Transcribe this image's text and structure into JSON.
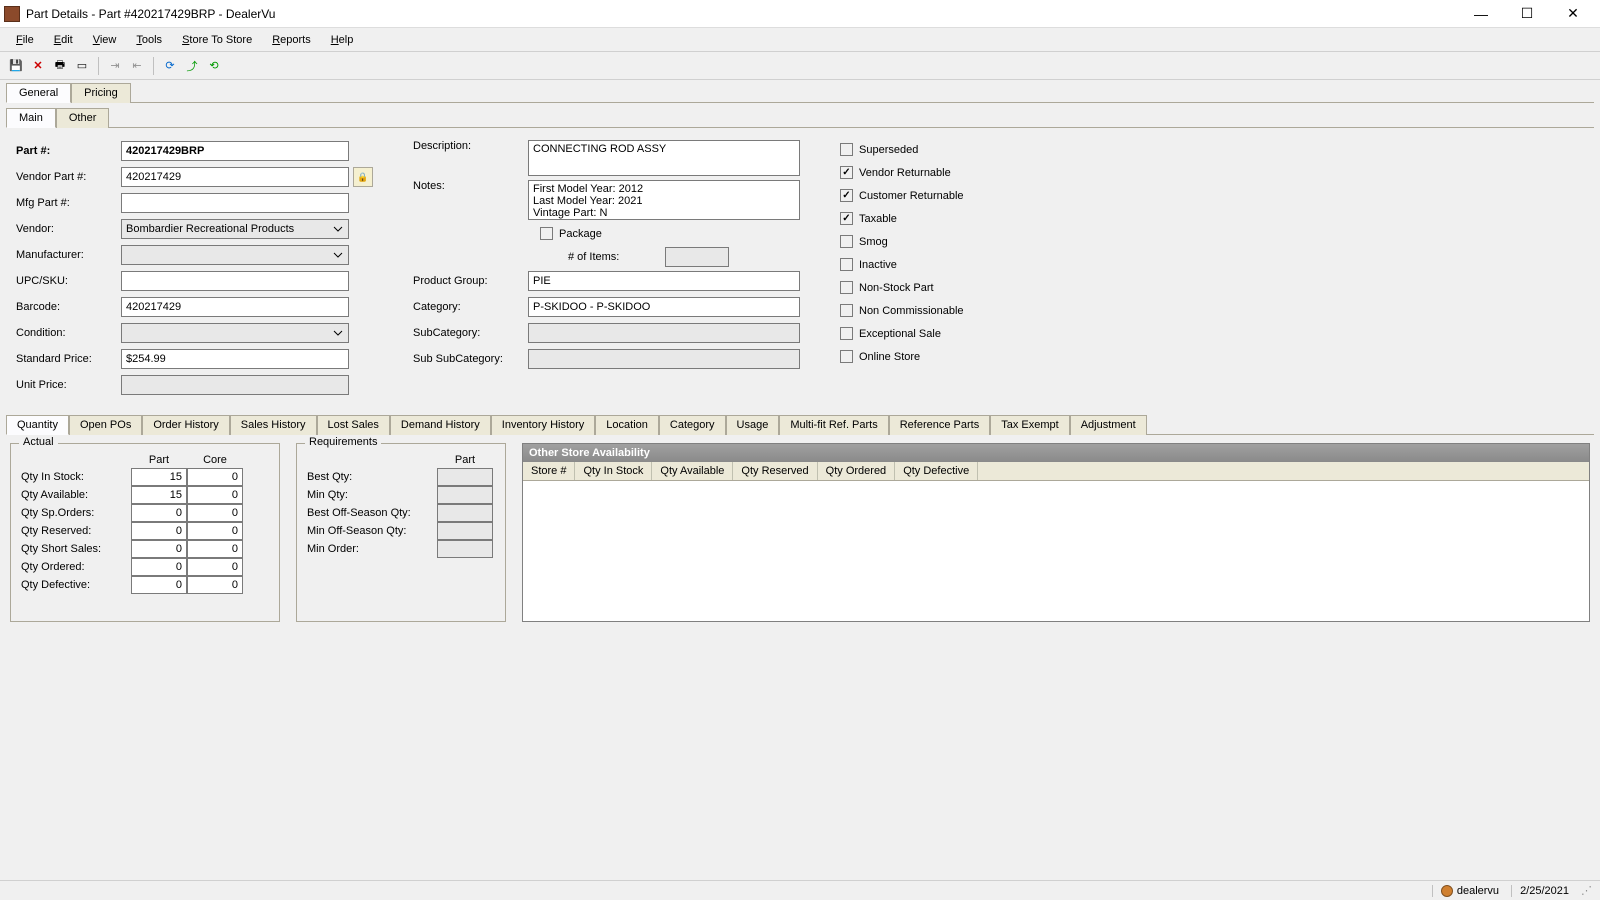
{
  "window": {
    "title": "Part Details - Part #420217429BRP - DealerVu"
  },
  "menu": {
    "file": "File",
    "edit": "Edit",
    "view": "View",
    "tools": "Tools",
    "store": "Store To Store",
    "reports": "Reports",
    "help": "Help"
  },
  "top_tabs": {
    "general": "General",
    "pricing": "Pricing"
  },
  "sub_tabs": {
    "main": "Main",
    "other": "Other"
  },
  "labels": {
    "part_no": "Part #:",
    "vendor_part": "Vendor Part #:",
    "mfg_part": "Mfg Part #:",
    "vendor": "Vendor:",
    "manufacturer": "Manufacturer:",
    "upc": "UPC/SKU:",
    "barcode": "Barcode:",
    "condition": "Condition:",
    "std_price": "Standard Price:",
    "unit_price": "Unit Price:",
    "description": "Description:",
    "notes": "Notes:",
    "package": "Package",
    "num_items": "# of Items:",
    "product_group": "Product Group:",
    "category": "Category:",
    "subcategory": "SubCategory:",
    "sub_sub": "Sub SubCategory:"
  },
  "fields": {
    "part_no": "420217429BRP",
    "vendor_part": "420217429",
    "mfg_part": "",
    "vendor": "Bombardier Recreational Products",
    "manufacturer": "",
    "upc": "",
    "barcode": "420217429",
    "condition": "",
    "std_price": "$254.99",
    "unit_price": "",
    "description": "CONNECTING ROD ASSY",
    "notes": "First Model Year: 2012\nLast Model Year: 2021\nVintage Part: N",
    "num_items": "",
    "product_group": "PIE",
    "category": "P-SKIDOO - P-SKIDOO",
    "subcategory": "",
    "sub_sub": ""
  },
  "checks": {
    "superseded": {
      "label": "Superseded",
      "checked": false
    },
    "vendor_ret": {
      "label": "Vendor Returnable",
      "checked": true
    },
    "cust_ret": {
      "label": "Customer Returnable",
      "checked": true
    },
    "taxable": {
      "label": "Taxable",
      "checked": true
    },
    "smog": {
      "label": "Smog",
      "checked": false
    },
    "inactive": {
      "label": "Inactive",
      "checked": false
    },
    "nonstock": {
      "label": "Non-Stock Part",
      "checked": false
    },
    "noncomm": {
      "label": "Non Commissionable",
      "checked": false
    },
    "excep": {
      "label": "Exceptional Sale",
      "checked": false
    },
    "online": {
      "label": "Online Store",
      "checked": false
    },
    "package": {
      "checked": false
    }
  },
  "lower_tabs": [
    "Quantity",
    "Open POs",
    "Order History",
    "Sales History",
    "Lost Sales",
    "Demand History",
    "Inventory History",
    "Location",
    "Category",
    "Usage",
    "Multi-fit Ref. Parts",
    "Reference Parts",
    "Tax Exempt",
    "Adjustment"
  ],
  "actual": {
    "legend": "Actual",
    "cols": {
      "part": "Part",
      "core": "Core"
    },
    "rows": [
      {
        "label": "Qty In Stock:",
        "part": "15",
        "core": "0"
      },
      {
        "label": "Qty Available:",
        "part": "15",
        "core": "0"
      },
      {
        "label": "Qty Sp.Orders:",
        "part": "0",
        "core": "0"
      },
      {
        "label": "Qty Reserved:",
        "part": "0",
        "core": "0"
      },
      {
        "label": "Qty Short Sales:",
        "part": "0",
        "core": "0"
      },
      {
        "label": "Qty Ordered:",
        "part": "0",
        "core": "0"
      },
      {
        "label": "Qty Defective:",
        "part": "0",
        "core": "0"
      }
    ]
  },
  "requirements": {
    "legend": "Requirements",
    "col": "Part",
    "rows": [
      {
        "label": "Best Qty:",
        "val": ""
      },
      {
        "label": "Min Qty:",
        "val": ""
      },
      {
        "label": "Best Off-Season Qty:",
        "val": ""
      },
      {
        "label": "Min Off-Season Qty:",
        "val": ""
      },
      {
        "label": "Min Order:",
        "val": ""
      }
    ]
  },
  "avail": {
    "title": "Other Store Availability",
    "cols": [
      "Store #",
      "Qty In Stock",
      "Qty Available",
      "Qty Reserved",
      "Qty Ordered",
      "Qty Defective"
    ]
  },
  "status": {
    "user": "dealervu",
    "date": "2/25/2021"
  }
}
